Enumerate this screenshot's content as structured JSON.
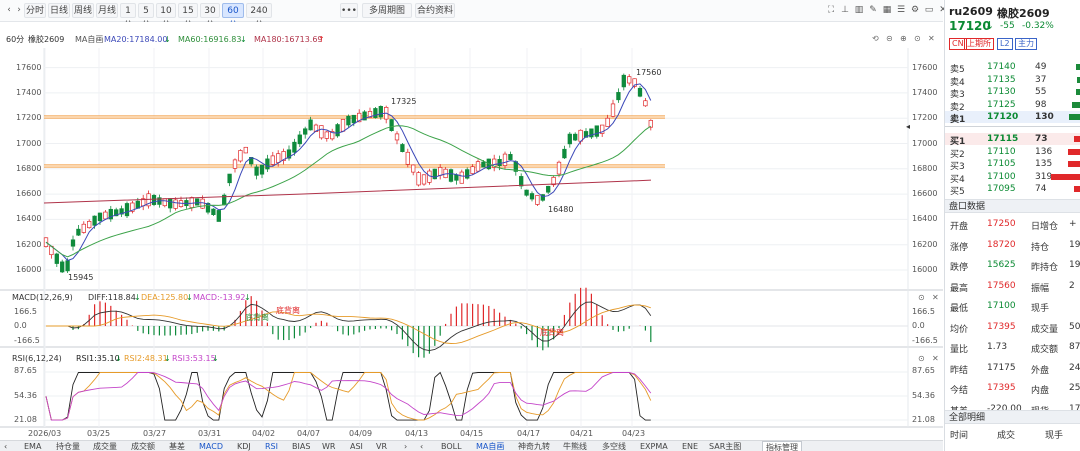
{
  "toolbar": {
    "periods": [
      "分时",
      "日线",
      "周线",
      "月线",
      "1分",
      "5分",
      "10分",
      "15分",
      "30分",
      "60分",
      "240分"
    ],
    "active_period": "60分",
    "multi_period": "多周期图",
    "contract_info": "合约资料",
    "more": "•••"
  },
  "main_chart": {
    "period_label": "60分",
    "contract_name": "橡胶2609",
    "ma_label": "MA自画",
    "ma20": "MA20:17184.00",
    "ma20_arrow": "↓",
    "ma60": "MA60:16916.83",
    "ma60_arrow": "↓",
    "ma180": "MA180:16713.69",
    "ma180_arrow": "↑",
    "y_ticks": [
      "17600",
      "17400",
      "17200",
      "17000",
      "16800",
      "16600",
      "16400",
      "16200",
      "16000"
    ],
    "hi_mark": "17560",
    "mid_mark": "17325",
    "lo_mark": "16480",
    "start_lo_mark": "15945"
  },
  "macd": {
    "title": "MACD(12,26,9)",
    "diff": "DIFF:118.84",
    "diff_arrow": "↓",
    "dea": "DEA:125.80",
    "dea_arrow": "↓",
    "macd": "MACD:-13.92",
    "macd_arrow": "↓",
    "y_ticks": [
      "166.5",
      "0.0",
      "-166.5"
    ],
    "ann1": "底背离",
    "ann2": "底背离",
    "ann3": "底背离"
  },
  "rsi": {
    "title": "RSI(6,12,24)",
    "rsi1": "RSI1:35.10",
    "rsi1_arrow": "↓",
    "rsi2": "RSI2:48.31",
    "rsi2_arrow": "↓",
    "rsi3": "RSI3:53.15",
    "rsi3_arrow": "↓",
    "y_ticks": [
      "87.65",
      "54.36",
      "21.08"
    ]
  },
  "x_axis": [
    "2026/03",
    "03/25",
    "03/27",
    "03/31",
    "04/02",
    "04/07",
    "04/09",
    "04/13",
    "04/15",
    "04/17",
    "04/21",
    "04/23"
  ],
  "bottom_tabs": [
    "EMA",
    "持仓量",
    "成交量",
    "成交额",
    "基差",
    "MACD",
    "KDJ",
    "RSI",
    "BIAS",
    "WR",
    "ASI",
    "VR",
    "BOLL",
    "MA自画",
    "神奇九转",
    "牛熊线",
    "多空线",
    "EXPMA",
    "ENE",
    "SAR主图",
    "指标管理"
  ],
  "bottom_active": [
    "MACD",
    "RSI",
    "MA自画"
  ],
  "stock": {
    "code": "ru2609",
    "name": "橡胶2609",
    "price": "17120",
    "arrow": "↓",
    "change": "-55",
    "pct": "-0.32%",
    "tags": [
      "CN",
      "上期所",
      "L2",
      "主力"
    ],
    "asks": [
      {
        "label": "卖5",
        "price": "17140",
        "vol": "49"
      },
      {
        "label": "卖4",
        "price": "17135",
        "vol": "37"
      },
      {
        "label": "卖3",
        "price": "17130",
        "vol": "55"
      },
      {
        "label": "卖2",
        "price": "17125",
        "vol": "98"
      },
      {
        "label": "卖1",
        "price": "17120",
        "vol": "130"
      }
    ],
    "bids": [
      {
        "label": "买1",
        "price": "17115",
        "vol": "73"
      },
      {
        "label": "买2",
        "price": "17110",
        "vol": "136"
      },
      {
        "label": "买3",
        "price": "17105",
        "vol": "135"
      },
      {
        "label": "买4",
        "price": "17100",
        "vol": "319"
      },
      {
        "label": "买5",
        "price": "17095",
        "vol": "74"
      }
    ],
    "ask_bar_fracs": [
      0.15,
      0.12,
      0.17,
      0.3,
      0.4
    ],
    "bid_bar_fracs": [
      0.23,
      0.43,
      0.42,
      1.0,
      0.23
    ],
    "section_market": "盘口数据",
    "stats": [
      {
        "k1": "开盘",
        "v1": "17250",
        "k2": "日增仓",
        "v2": "+"
      },
      {
        "k1": "涨停",
        "v1": "18720",
        "k2": "持仓",
        "v2": "19"
      },
      {
        "k1": "跌停",
        "v1": "15625",
        "k2": "昨持仓",
        "v2": "19"
      },
      {
        "k1": "最高",
        "v1": "17560",
        "k2": "振幅",
        "v2": "2"
      },
      {
        "k1": "最低",
        "v1": "17100",
        "k2": "现手",
        "v2": ""
      },
      {
        "k1": "均价",
        "v1": "17395",
        "k2": "成交量",
        "v2": "50"
      },
      {
        "k1": "量比",
        "v1": "1.73",
        "k2": "成交额",
        "v2": "875"
      },
      {
        "k1": "昨结",
        "v1": "17175",
        "k2": "外盘",
        "v2": "24"
      },
      {
        "k1": "今结",
        "v1": "17395",
        "k2": "内盘",
        "v2": "25"
      },
      {
        "k1": "基差",
        "v1": "-220.00",
        "k2": "现货",
        "v2": "170"
      }
    ],
    "section_trades": "全部明细",
    "trades_header": [
      "时间",
      "成交",
      "现手"
    ]
  }
}
